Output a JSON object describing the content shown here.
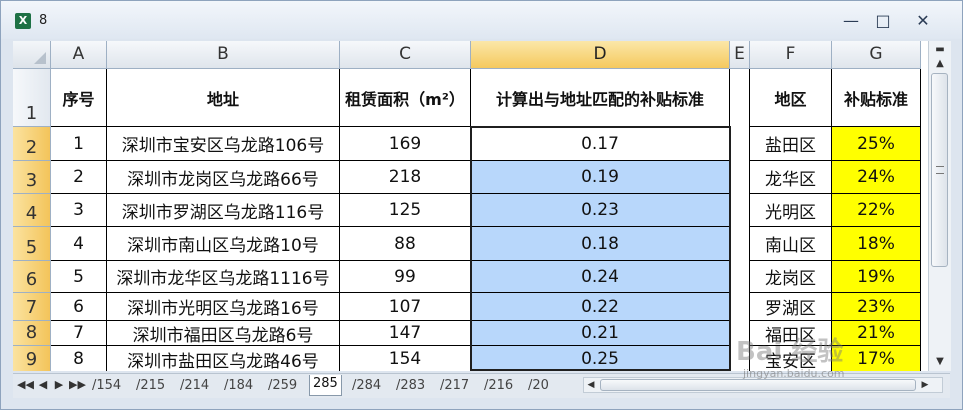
{
  "window": {
    "title": "8",
    "icon": "excel-icon",
    "controls": [
      "minimize-icon",
      "restore-icon",
      "close-icon"
    ]
  },
  "columns": [
    "A",
    "B",
    "C",
    "D",
    "E",
    "F",
    "G"
  ],
  "selected_column": "D",
  "rows": [
    "1",
    "2",
    "3",
    "4",
    "5",
    "6",
    "7",
    "8",
    "9"
  ],
  "header": {
    "seq": "序号",
    "address": "地址",
    "area": "租赁面积（m²）",
    "calc": "计算出与地址匹配的补贴标准",
    "district": "地区",
    "standard": "补贴标准"
  },
  "table": [
    {
      "seq": "1",
      "address": "深圳市宝安区乌龙路106号",
      "area": "169",
      "calc": "0.17",
      "district": "盐田区",
      "standard": "25%"
    },
    {
      "seq": "2",
      "address": "深圳市龙岗区乌龙路66号",
      "area": "218",
      "calc": "0.19",
      "district": "龙华区",
      "standard": "24%"
    },
    {
      "seq": "3",
      "address": "深圳市罗湖区乌龙路116号",
      "area": "125",
      "calc": "0.23",
      "district": "光明区",
      "standard": "22%"
    },
    {
      "seq": "4",
      "address": "深圳市南山区乌龙路10号",
      "area": "88",
      "calc": "0.18",
      "district": "南山区",
      "standard": "18%"
    },
    {
      "seq": "5",
      "address": "深圳市龙华区乌龙路1116号",
      "area": "99",
      "calc": "0.24",
      "district": "龙岗区",
      "standard": "19%"
    },
    {
      "seq": "6",
      "address": "深圳市光明区乌龙路16号",
      "area": "107",
      "calc": "0.22",
      "district": "罗湖区",
      "standard": "23%"
    },
    {
      "seq": "7",
      "address": "深圳市福田区乌龙路6号",
      "area": "147",
      "calc": "0.21",
      "district": "福田区",
      "standard": "21%"
    },
    {
      "seq": "8",
      "address": "深圳市盐田区乌龙路46号",
      "area": "154",
      "calc": "0.25",
      "district": "宝安区",
      "standard": "17%"
    }
  ],
  "sheet_tabs": [
    "154",
    "215",
    "214",
    "184",
    "259",
    "285",
    "284",
    "283",
    "217",
    "216",
    "20"
  ],
  "active_tab": "285",
  "watermark": {
    "text": "Bai 经验",
    "url": "jingyan.baidu.com"
  },
  "colors": {
    "selection_fill": "#b8d7fb",
    "highlight_fill": "#ffff00",
    "selected_header": "#f5c95e"
  }
}
